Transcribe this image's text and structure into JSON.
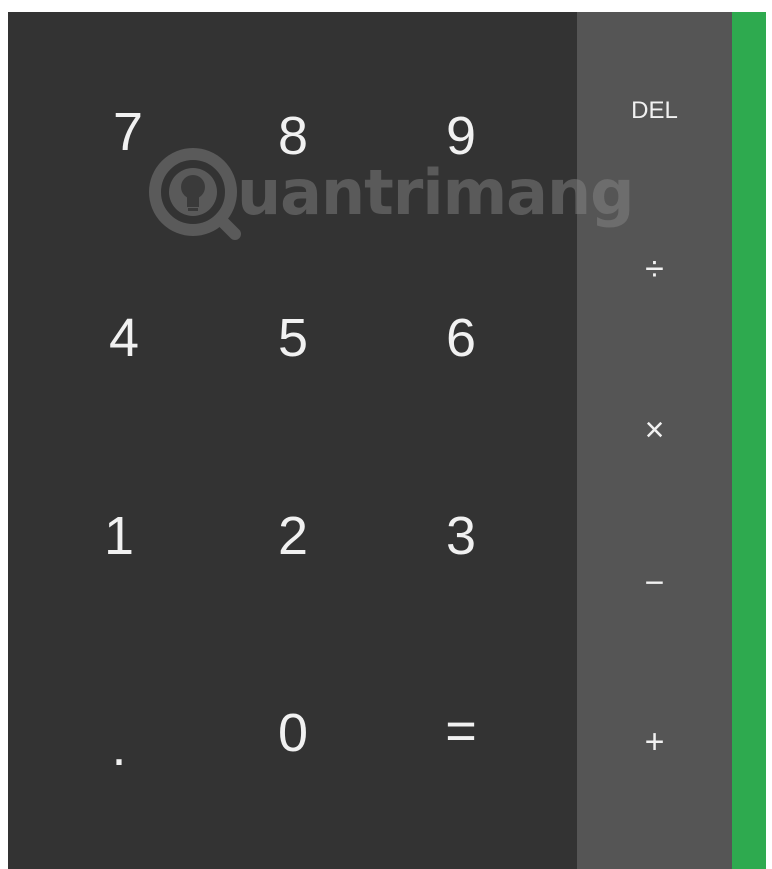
{
  "calculator": {
    "digits": {
      "seven": "7",
      "eight": "8",
      "nine": "9",
      "four": "4",
      "five": "5",
      "six": "6",
      "one": "1",
      "two": "2",
      "three": "3",
      "decimal": ".",
      "zero": "0",
      "equals": "="
    },
    "operators": {
      "delete": "DEL",
      "divide": "÷",
      "multiply": "×",
      "subtract": "−",
      "add": "+"
    }
  },
  "watermark": {
    "text": "uantrimang"
  },
  "colors": {
    "numpad_bg": "#333333",
    "operator_bg": "#555555",
    "accent": "#2eaa4f",
    "key_text": "#f1f1f1"
  }
}
